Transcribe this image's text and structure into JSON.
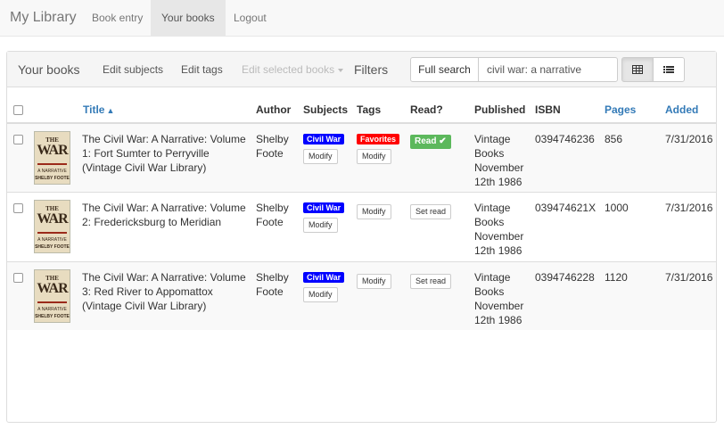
{
  "nav": {
    "brand": "My Library",
    "items": [
      {
        "label": "Book entry"
      },
      {
        "label": "Your books"
      },
      {
        "label": "Logout"
      }
    ]
  },
  "panel": {
    "title": "Your books",
    "edit_subjects": "Edit subjects",
    "edit_tags": "Edit tags",
    "edit_selected": "Edit selected books",
    "filters_label": "Filters",
    "search_button": "Full search",
    "search_value": "civil war: a narrative",
    "view_modes": [
      {
        "icon": "table-grid-icon",
        "active": true
      },
      {
        "icon": "list-icon",
        "active": false
      }
    ]
  },
  "table": {
    "columns": {
      "title": "Title",
      "author": "Author",
      "subjects": "Subjects",
      "tags": "Tags",
      "read": "Read?",
      "published": "Published",
      "isbn": "ISBN",
      "pages": "Pages",
      "added": "Added"
    },
    "rows": [
      {
        "title": "The Civil War: A Narrative: Volume 1: Fort Sumter to Perryville (Vintage Civil War Library)",
        "author": "Shelby Foote",
        "subject": "Civil War",
        "tag": "Favorites",
        "read_status": "Read",
        "modify": "Modify",
        "publisher": "Vintage Books",
        "published_date": "November 12th 1986",
        "isbn": "0394746236",
        "pages": "856",
        "added": "7/31/2016"
      },
      {
        "title": "The Civil War: A Narrative: Volume 2: Fredericksburg to Meridian",
        "author": "Shelby Foote",
        "subject": "Civil War",
        "tag": "",
        "read_status": "Set read",
        "modify": "Modify",
        "publisher": "Vintage Books",
        "published_date": "November 12th 1986",
        "isbn": "039474621X",
        "pages": "1000",
        "added": "7/31/2016"
      },
      {
        "title": "The Civil War: A Narrative: Volume 3: Red River to Appomattox (Vintage Civil War Library)",
        "author": "Shelby Foote",
        "subject": "Civil War",
        "tag": "",
        "read_status": "Set read",
        "modify": "Modify",
        "publisher": "Vintage Books",
        "published_date": "November 12th 1986",
        "isbn": "0394746228",
        "pages": "1120",
        "added": "7/31/2016"
      }
    ],
    "cover": {
      "line1": "THE",
      "line2": "CIVIL WAR",
      "line3": "A NARRATIVE",
      "author": "SHELBY FOOTE"
    }
  },
  "colors": {
    "subject_label": "#0000ff",
    "tag_label": "#ff0000",
    "read_label": "#5cb85c",
    "link": "#337ab7"
  }
}
